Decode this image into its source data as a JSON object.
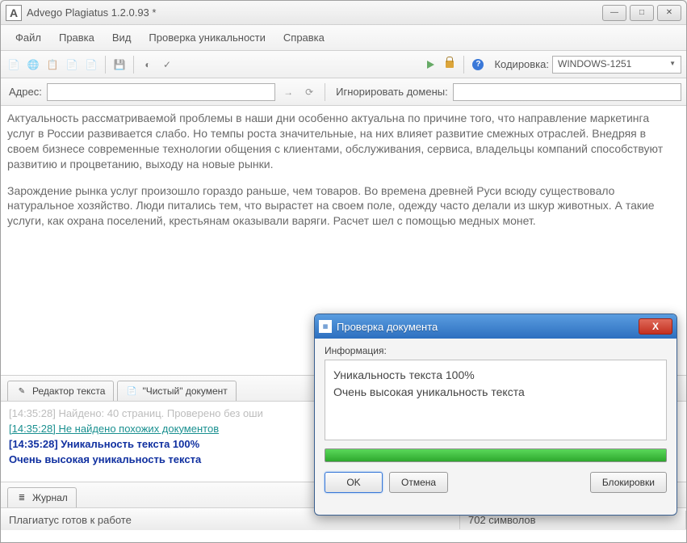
{
  "window": {
    "title": "Advego Plagiatus 1.2.0.93 *",
    "app_letter": "A"
  },
  "menu": {
    "file": "Файл",
    "edit": "Правка",
    "view": "Вид",
    "check": "Проверка уникальности",
    "help": "Справка"
  },
  "toolbar": {
    "encoding_label": "Кодировка:",
    "encoding_value": "WINDOWS-1251",
    "help_symbol": "?"
  },
  "address": {
    "label": "Адрес:",
    "value": "",
    "ignore_label": "Игнорировать домены:",
    "ignore_value": ""
  },
  "content": {
    "p1": "Актуальность рассматриваемой проблемы в наши дни особенно актуальна по причине того, что направление маркетинга услуг в России развивается слабо. Но темпы роста значительные, на них влияет развитие смежных отраслей. Внедряя в своем бизнесе современные технологии общения с клиентами, обслуживания, сервиса, владельцы компаний способствуют развитию и процветанию, выходу на новые рынки.",
    "p2": "Зарождение рынка услуг произошло гораздо раньше, чем товаров. Во времена древней Руси всюду существовало натуральное хозяйство. Люди питались тем, что вырастет на своем поле, одежду часто делали из шкур животных. А такие услуги, как охрана поселений, крестьянам оказывали варяги. Расчет шел с помощью медных монет."
  },
  "tabs": {
    "editor": "Редактор текста",
    "clean": "\"Чистый\" документ",
    "journal": "Журнал"
  },
  "log": {
    "l1": "[14:35:28] Найдено: 40 страниц. Проверено без оши",
    "l2": "[14:35:28] Не найдено похожих документов",
    "l3": "[14:35:28] Уникальность текста 100%",
    "l4": "Очень высокая уникальность текста"
  },
  "status": {
    "ready": "Плагиатус готов к работе",
    "symbols": "702 символов"
  },
  "dialog": {
    "title": "Проверка документа",
    "info_label": "Информация:",
    "line1": "Уникальность текста 100%",
    "line2": "Очень высокая уникальность текста",
    "ok": "OK",
    "cancel": "Отмена",
    "block": "Блокировки",
    "close_x": "X"
  }
}
